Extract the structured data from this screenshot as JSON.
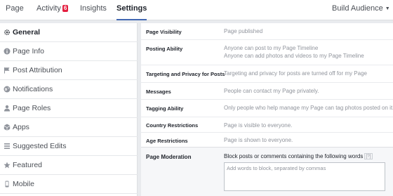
{
  "topnav": {
    "tabs": [
      {
        "label": "Page"
      },
      {
        "label": "Activity",
        "badge": "6"
      },
      {
        "label": "Insights"
      },
      {
        "label": "Settings"
      }
    ],
    "build_audience": "Build Audience",
    "accent_color": "#4267b2",
    "badge_color": "#e41e3f"
  },
  "sidebar": {
    "items": [
      {
        "label": "General",
        "icon": "gear-icon",
        "active": true
      },
      {
        "label": "Page Info",
        "icon": "info-icon"
      },
      {
        "label": "Post Attribution",
        "icon": "flag-icon"
      },
      {
        "label": "Notifications",
        "icon": "globe-icon"
      },
      {
        "label": "Page Roles",
        "icon": "person-icon"
      },
      {
        "label": "Apps",
        "icon": "apps-cube-icon"
      },
      {
        "label": "Suggested Edits",
        "icon": "edit-list-icon"
      },
      {
        "label": "Featured",
        "icon": "star-icon"
      },
      {
        "label": "Mobile",
        "icon": "mobile-phone-icon"
      }
    ]
  },
  "settings": {
    "rows": [
      {
        "label": "Page Visibility",
        "values": [
          "Page published"
        ]
      },
      {
        "label": "Posting Ability",
        "values": [
          "Anyone can post to my Page Timeline",
          "Anyone can add photos and videos to my Page Timeline"
        ]
      },
      {
        "label": "Targeting and Privacy for Posts",
        "values": [
          "Targeting and privacy for posts are turned off for my Page"
        ]
      },
      {
        "label": "Messages",
        "values": [
          "People can contact my Page privately."
        ]
      },
      {
        "label": "Tagging Ability",
        "values": [
          "Only people who help manage my Page can tag photos posted on it."
        ]
      },
      {
        "label": "Country Restrictions",
        "values": [
          "Page is visible to everyone."
        ]
      },
      {
        "label": "Age Restrictions",
        "values": [
          "Page is shown to everyone."
        ]
      }
    ],
    "moderation": {
      "label": "Page Moderation",
      "description": "Block posts or comments containing the following words",
      "help": "[?]",
      "input_value": "",
      "input_placeholder": "Add words to block, separated by commas"
    }
  }
}
